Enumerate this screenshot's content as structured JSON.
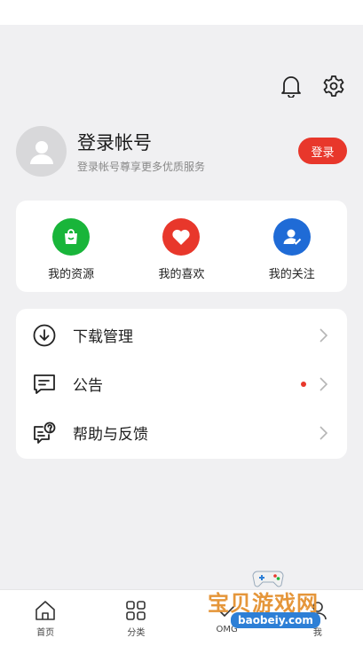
{
  "profile": {
    "title": "登录帐号",
    "subtitle": "登录帐号尊享更多优质服务",
    "login_button": "登录"
  },
  "quick_actions": [
    {
      "label": "我的资源",
      "icon": "shopping-bag-icon",
      "color": "#19b53a"
    },
    {
      "label": "我的喜欢",
      "icon": "heart-icon",
      "color": "#e8372b"
    },
    {
      "label": "我的关注",
      "icon": "user-check-icon",
      "color": "#1f6bd6"
    }
  ],
  "menu": [
    {
      "label": "下载管理",
      "icon": "download-icon",
      "badge": false
    },
    {
      "label": "公告",
      "icon": "message-icon",
      "badge": true
    },
    {
      "label": "帮助与反馈",
      "icon": "help-feedback-icon",
      "badge": false
    }
  ],
  "tabs": [
    {
      "label": "首页",
      "icon": "home-icon"
    },
    {
      "label": "分类",
      "icon": "grid-icon"
    },
    {
      "label": "OMG",
      "icon": "check-icon"
    },
    {
      "label": "我",
      "icon": "profile-icon"
    }
  ],
  "watermark": {
    "text": "宝贝游戏网",
    "url": "baobeiy.com"
  },
  "colors": {
    "accent": "#e8372b",
    "background": "#f0f0f2"
  }
}
